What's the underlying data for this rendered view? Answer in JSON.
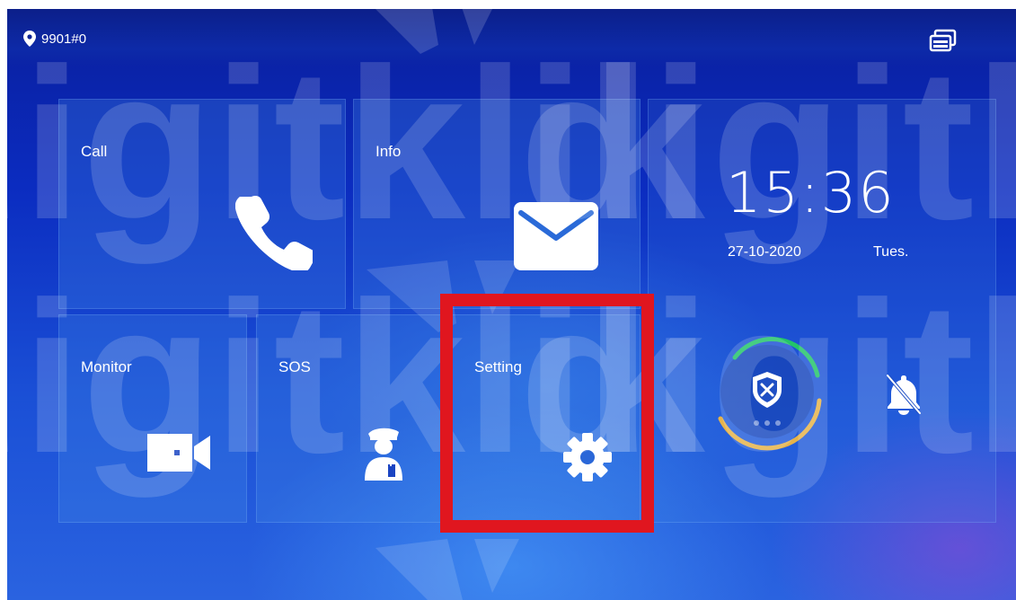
{
  "status_bar": {
    "location": "9901#0"
  },
  "tiles": {
    "call": {
      "label": "Call"
    },
    "info": {
      "label": "Info"
    },
    "monitor": {
      "label": "Monitor"
    },
    "sos": {
      "label": "SOS"
    },
    "setting": {
      "label": "Setting"
    }
  },
  "clock": {
    "time": "15:36",
    "date": "27-10-2020",
    "day": "Tues."
  },
  "watermark": {
    "text": "digitklik"
  },
  "colors": {
    "highlight": "#e0161f",
    "arm_ring_green": "#23c46a",
    "arm_ring_gold": "#e6b34a"
  },
  "icons": {
    "location": "map-pin-icon",
    "screens": "stacked-screens-icon",
    "call": "phone-icon",
    "info": "envelope-icon",
    "monitor": "video-camera-icon",
    "sos": "security-guard-icon",
    "setting": "gear-icon",
    "arm": "shield-x-icon",
    "mute": "bell-muted-icon"
  }
}
